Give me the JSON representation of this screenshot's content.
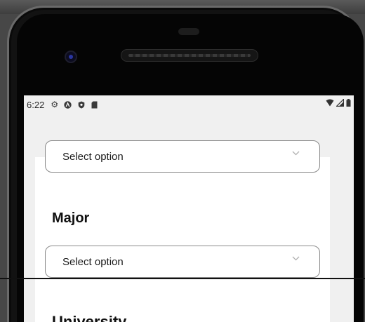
{
  "status_bar": {
    "time": "6:22",
    "left_icons": [
      "gear-icon",
      "a-circle-icon",
      "shield-icon",
      "sd-card-icon"
    ],
    "right_icons": [
      "wifi-icon",
      "signal-icon",
      "battery-icon"
    ]
  },
  "form": {
    "first_select": {
      "value": "Select option"
    },
    "major": {
      "label": "Major",
      "value": "Select option"
    },
    "university": {
      "label": "University"
    }
  }
}
